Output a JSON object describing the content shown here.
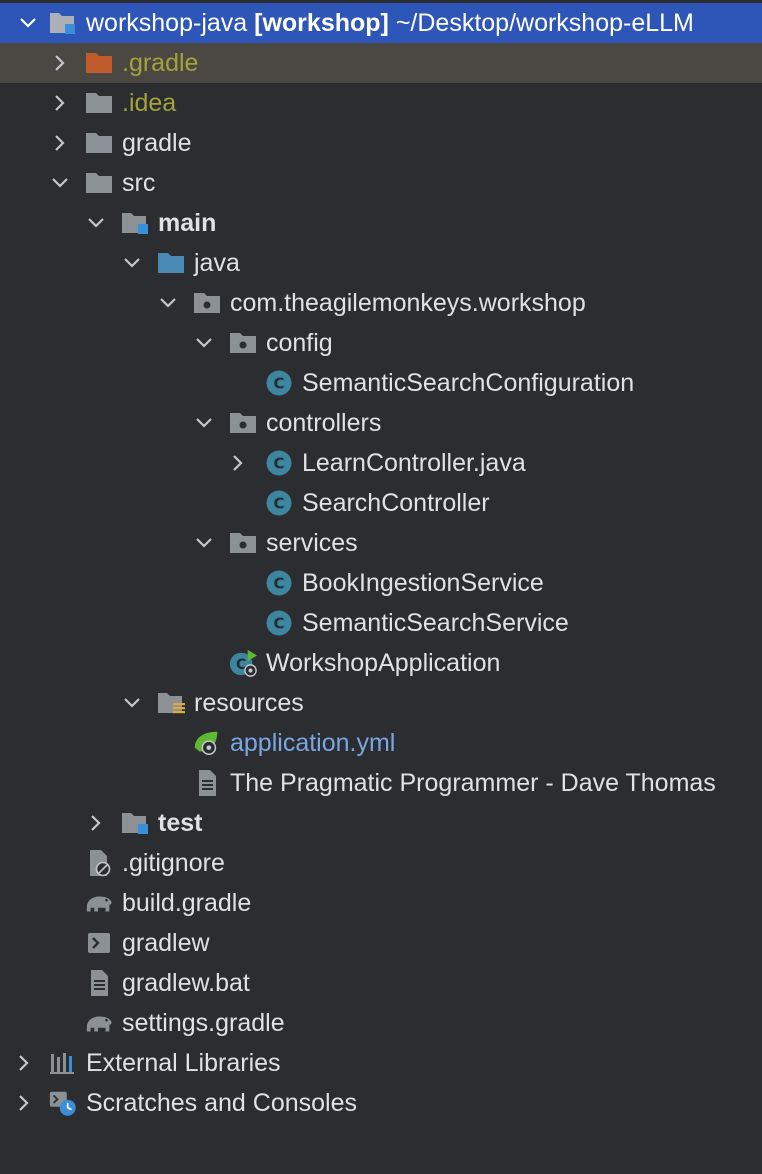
{
  "tree": {
    "root": {
      "name": "workshop-java",
      "module": "[workshop]",
      "path": "~/Desktop/workshop-eLLM"
    },
    "items": {
      "gradle_dot": ".gradle",
      "idea": ".idea",
      "gradle": "gradle",
      "src": "src",
      "main": "main",
      "java": "java",
      "package": "com.theagilemonkeys.workshop",
      "config": "config",
      "semantic_search_configuration": "SemanticSearchConfiguration",
      "controllers": "controllers",
      "learn_controller": "LearnController.java",
      "search_controller": "SearchController",
      "services": "services",
      "book_ingestion_service": "BookIngestionService",
      "semantic_search_service": "SemanticSearchService",
      "workshop_application": "WorkshopApplication",
      "resources": "resources",
      "application_yml": "application.yml",
      "pragmatic_programmer": "The Pragmatic Programmer  - Dave Thomas",
      "test": "test",
      "gitignore": ".gitignore",
      "build_gradle": "build.gradle",
      "gradlew": "gradlew",
      "gradlew_bat": "gradlew.bat",
      "settings_gradle": "settings.gradle",
      "external_libraries": "External Libraries",
      "scratches": "Scratches and Consoles"
    }
  },
  "colors": {
    "background": "#2b2d30",
    "selection": "#2e55b8",
    "hover_row": "#4b4844",
    "excluded_text": "#a3a33a",
    "class_icon": "#3e86a0",
    "folder": "#8c9196",
    "source_folder": "#4a88b5",
    "link_text": "#7aa7e4"
  },
  "icons": {
    "root": "module-folder-icon",
    "gradle_dot": "excluded-folder-icon",
    "idea": "folder-icon",
    "gradle": "folder-icon",
    "src": "folder-icon",
    "main": "source-root-folder-icon",
    "java": "source-folder-icon",
    "package": "package-icon",
    "class": "class-icon",
    "spring_boot": "spring-boot-app-icon",
    "resources": "resources-folder-icon",
    "yml": "spring-config-icon",
    "text_file": "text-file-icon",
    "test": "test-root-folder-icon",
    "gitignore": "ignore-file-icon",
    "gradle_file": "gradle-elephant-icon",
    "shell": "shell-script-icon",
    "bat": "batch-file-icon",
    "libraries": "libraries-icon",
    "scratches": "scratches-icon"
  }
}
